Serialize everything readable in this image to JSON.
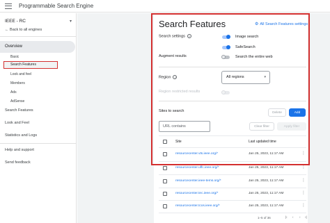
{
  "app": {
    "title": "Programmable Search Engine"
  },
  "sidebar": {
    "engine_name": "IEEE - RC",
    "back_label": "Back to all engines",
    "overview_label": "Overview",
    "sub_items": [
      "Basic",
      "Search Features",
      "Look and feel",
      "Members",
      "Ads",
      "AdSense"
    ],
    "items": [
      "Search Features",
      "Look and Feel",
      "Statistics and Logs",
      "Help and support",
      "Send feedback"
    ]
  },
  "main": {
    "title": "Search Features",
    "all_settings_link": "All Search Features settings",
    "search_settings_label": "Search settings",
    "augment_results_label": "Augment results",
    "toggles": [
      {
        "label": "Image search",
        "state": "on"
      },
      {
        "label": "SafeSearch",
        "state": "on"
      },
      {
        "label": "Search the entire web",
        "state": "off"
      }
    ],
    "region_label": "Region",
    "region_value": "All regions",
    "region_restricted_label": "Region restricted results",
    "sites_label": "Sites to search",
    "delete_button": "Delete",
    "add_button": "Add",
    "url_placeholder": "URL contains",
    "clear_filter_button": "Clear filter",
    "apply_filter_button": "Apply filter",
    "table": {
      "col_site": "Site",
      "col_updated": "Last updated time",
      "rows": [
        {
          "site": "resourcecenter.vts.ieee.org/*",
          "updated": "Jan 25, 2023, 11:17 AM"
        },
        {
          "site": "resourcecenter.uffc.ieee.org/*",
          "updated": "Jan 25, 2023, 11:17 AM"
        },
        {
          "site": "resourcecenter.ieee-tems.org/*",
          "updated": "Jan 25, 2023, 11:17 AM"
        },
        {
          "site": "resourcecenter.tec.ieee.org/*",
          "updated": "Jan 25, 2023, 11:17 AM"
        },
        {
          "site": "resourcecenter.tcos.ieee.org/*",
          "updated": "Jan 25, 2023, 11:17 AM"
        }
      ]
    },
    "pagination": "1–5 of 36"
  },
  "colors": {
    "accent": "#1a73e8",
    "highlight": "#d32f2f"
  }
}
